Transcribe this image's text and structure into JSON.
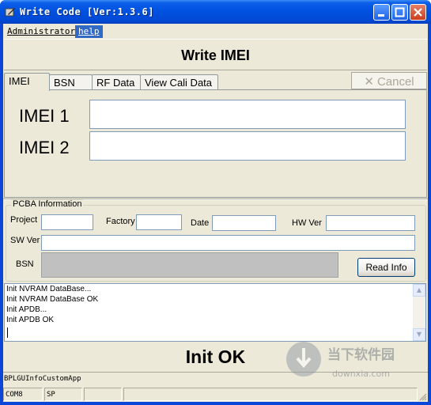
{
  "window": {
    "title": "Write Code [Ver:1.3.6]"
  },
  "menu": [
    {
      "label": "Administrator"
    },
    {
      "label": "help"
    }
  ],
  "header": {
    "title": "Write IMEI"
  },
  "tabs": [
    {
      "label": "IMEI"
    },
    {
      "label": "BSN"
    },
    {
      "label": "RF Data"
    },
    {
      "label": "View Cali Data"
    }
  ],
  "cancel_label": "Cancel",
  "imei": {
    "label1": "IMEI 1",
    "value1": "",
    "label2": "IMEI 2",
    "value2": ""
  },
  "pcba": {
    "legend": "PCBA Information",
    "project_label": "Project",
    "project": "",
    "factory_label": "Factory",
    "factory": "",
    "date_label": "Date",
    "date": "",
    "hwver_label": "HW Ver",
    "hwver": "",
    "swver_label": "SW Ver",
    "swver": "",
    "bsn_label": "BSN",
    "bsn": ""
  },
  "read_info_label": "Read Info",
  "log": [
    "Init NVRAM DataBase...",
    "Init NVRAM DataBase OK",
    "Init APDB...",
    "Init APDB OK"
  ],
  "status_message": "Init OK",
  "info_bar": "BPLGUInfoCustomApp",
  "statusbar": {
    "port": "COM8",
    "mode": "SP"
  },
  "watermark": {
    "text": "当下软件园",
    "url": "downxia.com"
  },
  "colors": {
    "titlebar": "#0052e0",
    "face": "#ece9d8",
    "accent": "#316ac5"
  }
}
